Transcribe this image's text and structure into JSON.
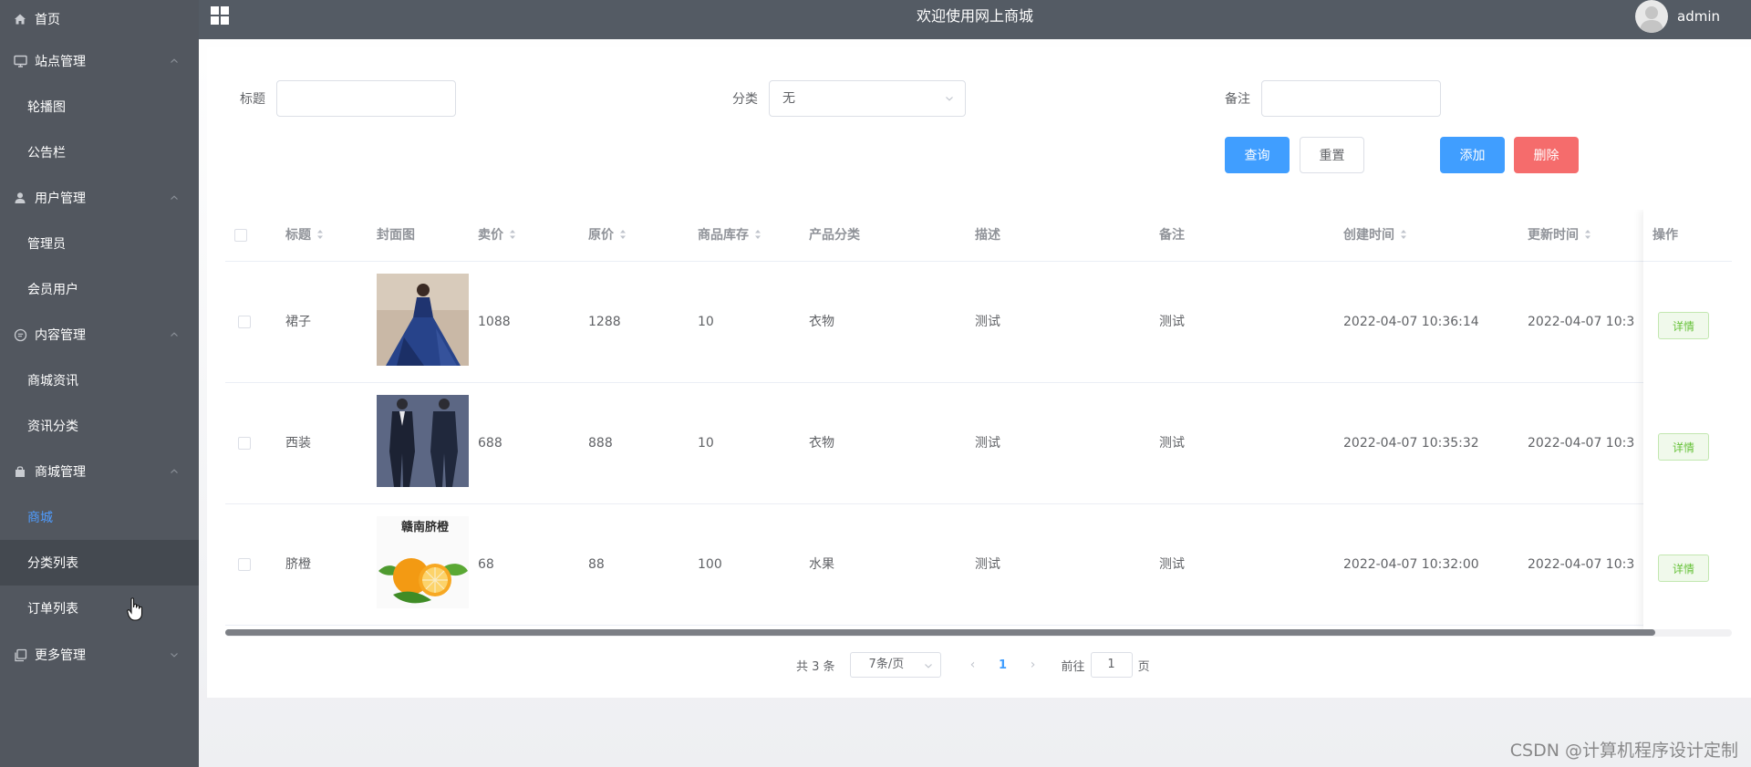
{
  "header": {
    "title": "欢迎使用网上商城",
    "user_name": "admin"
  },
  "sidebar": {
    "home": "首页",
    "groups": [
      {
        "label": "站点管理",
        "icon": "monitor-icon",
        "items": [
          "轮播图",
          "公告栏"
        ]
      },
      {
        "label": "用户管理",
        "icon": "user-icon",
        "items": [
          "管理员",
          "会员用户"
        ]
      },
      {
        "label": "内容管理",
        "icon": "chat-icon",
        "items": [
          "商城资讯",
          "资讯分类"
        ]
      },
      {
        "label": "商城管理",
        "icon": "bag-icon",
        "items": [
          "商城",
          "分类列表",
          "订单列表"
        ]
      },
      {
        "label": "更多管理",
        "icon": "copy-icon",
        "items": []
      }
    ],
    "active_item": "商城",
    "hover_item": "分类列表"
  },
  "search": {
    "title_label": "标题",
    "title_value": "",
    "category_label": "分类",
    "category_value": "无",
    "remark_label": "备注",
    "remark_value": ""
  },
  "actions": {
    "query": "查询",
    "reset": "重置",
    "add": "添加",
    "delete": "删除"
  },
  "table": {
    "columns": [
      "标题",
      "封面图",
      "卖价",
      "原价",
      "商品库存",
      "产品分类",
      "描述",
      "备注",
      "创建时间",
      "更新时间",
      "操作"
    ],
    "rows": [
      {
        "title": "裙子",
        "cover": "dress-image",
        "price": "1088",
        "original_price": "1288",
        "stock": "10",
        "category": "衣物",
        "description": "测试",
        "remark": "测试",
        "created": "2022-04-07 10:36:14",
        "updated": "2022-04-07 10:3",
        "action": "详情"
      },
      {
        "title": "西装",
        "cover": "suit-image",
        "price": "688",
        "original_price": "888",
        "stock": "10",
        "category": "衣物",
        "description": "测试",
        "remark": "测试",
        "created": "2022-04-07 10:35:32",
        "updated": "2022-04-07 10:3",
        "action": "详情"
      },
      {
        "title": "脐橙",
        "cover": "orange-image",
        "price": "68",
        "original_price": "88",
        "stock": "100",
        "category": "水果",
        "description": "测试",
        "remark": "测试",
        "created": "2022-04-07 10:32:00",
        "updated": "2022-04-07 10:3",
        "action": "详情"
      }
    ]
  },
  "pagination": {
    "total": "共 3 条",
    "page_size": "7条/页",
    "current_page": "1",
    "goto_prefix": "前往",
    "goto_value": "1",
    "goto_suffix": "页"
  },
  "thumb_text": {
    "orange_title": "赣南脐橙"
  },
  "watermark": "CSDN @计算机程序设计定制"
}
